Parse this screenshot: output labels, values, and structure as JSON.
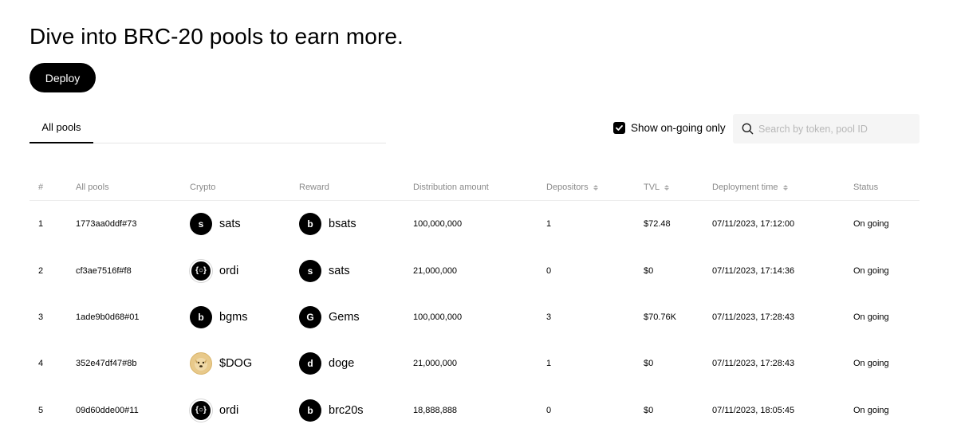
{
  "header": {
    "title": "Dive into BRC-20 pools to earn more.",
    "deploy_label": "Deploy"
  },
  "tabs": [
    {
      "label": "All pools",
      "active": true
    }
  ],
  "filter": {
    "show_ongoing_label": "Show on-going only",
    "checked": true
  },
  "search": {
    "placeholder": "Search by token, pool ID",
    "value": ""
  },
  "table": {
    "columns": {
      "num": "#",
      "pool": "All pools",
      "crypto": "Crypto",
      "reward": "Reward",
      "distribution": "Distribution amount",
      "depositors": "Depositors",
      "tvl": "TVL",
      "deployment_time": "Deployment time",
      "status": "Status"
    },
    "rows": [
      {
        "num": "1",
        "pool": "1773aa0ddf#73",
        "crypto": "sats",
        "crypto_icon": "s",
        "reward": "bsats",
        "reward_icon": "b",
        "distribution": "100,000,000",
        "depositors": "1",
        "tvl": "$72.48",
        "time": "07/11/2023, 17:12:00",
        "status": "On going"
      },
      {
        "num": "2",
        "pool": "cf3ae7516f#f8",
        "crypto": "ordi",
        "crypto_icon": "{○}",
        "reward": "sats",
        "reward_icon": "s",
        "distribution": "21,000,000",
        "depositors": "0",
        "tvl": "$0",
        "time": "07/11/2023, 17:14:36",
        "status": "On going"
      },
      {
        "num": "3",
        "pool": "1ade9b0d68#01",
        "crypto": "bgms",
        "crypto_icon": "b",
        "reward": "Gems",
        "reward_icon": "G",
        "distribution": "100,000,000",
        "depositors": "3",
        "tvl": "$70.76K",
        "time": "07/11/2023, 17:28:43",
        "status": "On going"
      },
      {
        "num": "4",
        "pool": "352e47df47#8b",
        "crypto": "$DOG",
        "crypto_icon": "dog",
        "reward": "doge",
        "reward_icon": "d",
        "distribution": "21,000,000",
        "depositors": "1",
        "tvl": "$0",
        "time": "07/11/2023, 17:28:43",
        "status": "On going"
      },
      {
        "num": "5",
        "pool": "09d60dde00#11",
        "crypto": "ordi",
        "crypto_icon": "{○}",
        "reward": "brc20s",
        "reward_icon": "b",
        "distribution": "18,888,888",
        "depositors": "0",
        "tvl": "$0",
        "time": "07/11/2023, 18:05:45",
        "status": "On going"
      }
    ]
  }
}
